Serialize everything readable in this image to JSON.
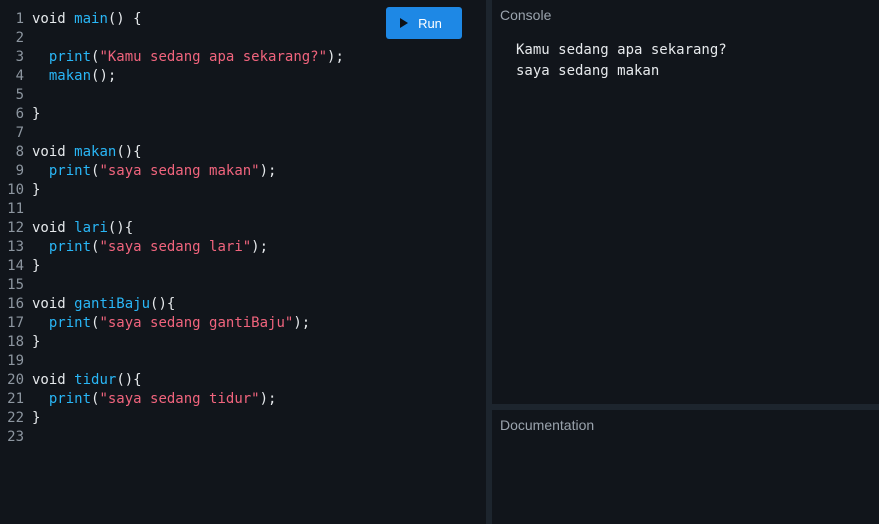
{
  "editor": {
    "run_label": "Run",
    "lines": [
      [
        {
          "t": "void ",
          "c": "plain"
        },
        {
          "t": "main",
          "c": "fn"
        },
        {
          "t": "() {",
          "c": "plain"
        }
      ],
      [],
      [
        {
          "t": "  ",
          "c": "plain"
        },
        {
          "t": "print",
          "c": "fn"
        },
        {
          "t": "(",
          "c": "plain"
        },
        {
          "t": "\"Kamu sedang apa sekarang?\"",
          "c": "str"
        },
        {
          "t": ");",
          "c": "plain"
        }
      ],
      [
        {
          "t": "  ",
          "c": "plain"
        },
        {
          "t": "makan",
          "c": "fn"
        },
        {
          "t": "();",
          "c": "plain"
        }
      ],
      [],
      [
        {
          "t": "}",
          "c": "plain"
        }
      ],
      [],
      [
        {
          "t": "void ",
          "c": "plain"
        },
        {
          "t": "makan",
          "c": "fn"
        },
        {
          "t": "(){",
          "c": "plain"
        }
      ],
      [
        {
          "t": "  ",
          "c": "plain"
        },
        {
          "t": "print",
          "c": "fn"
        },
        {
          "t": "(",
          "c": "plain"
        },
        {
          "t": "\"saya sedang makan\"",
          "c": "str"
        },
        {
          "t": ");",
          "c": "plain"
        }
      ],
      [
        {
          "t": "}",
          "c": "plain"
        }
      ],
      [],
      [
        {
          "t": "void ",
          "c": "plain"
        },
        {
          "t": "lari",
          "c": "fn"
        },
        {
          "t": "(){",
          "c": "plain"
        }
      ],
      [
        {
          "t": "  ",
          "c": "plain"
        },
        {
          "t": "print",
          "c": "fn"
        },
        {
          "t": "(",
          "c": "plain"
        },
        {
          "t": "\"saya sedang lari\"",
          "c": "str"
        },
        {
          "t": ");",
          "c": "plain"
        }
      ],
      [
        {
          "t": "}",
          "c": "plain"
        }
      ],
      [],
      [
        {
          "t": "void ",
          "c": "plain"
        },
        {
          "t": "gantiBaju",
          "c": "fn"
        },
        {
          "t": "(){",
          "c": "plain"
        }
      ],
      [
        {
          "t": "  ",
          "c": "plain"
        },
        {
          "t": "print",
          "c": "fn"
        },
        {
          "t": "(",
          "c": "plain"
        },
        {
          "t": "\"saya sedang gantiBaju\"",
          "c": "str"
        },
        {
          "t": ");",
          "c": "plain"
        }
      ],
      [
        {
          "t": "}",
          "c": "plain"
        }
      ],
      [],
      [
        {
          "t": "void ",
          "c": "plain"
        },
        {
          "t": "tidur",
          "c": "fn"
        },
        {
          "t": "(){",
          "c": "plain"
        }
      ],
      [
        {
          "t": "  ",
          "c": "plain"
        },
        {
          "t": "print",
          "c": "fn"
        },
        {
          "t": "(",
          "c": "plain"
        },
        {
          "t": "\"saya sedang tidur\"",
          "c": "str"
        },
        {
          "t": ");",
          "c": "plain"
        }
      ],
      [
        {
          "t": "}",
          "c": "plain"
        }
      ],
      []
    ]
  },
  "console": {
    "title": "Console",
    "output": "Kamu sedang apa sekarang?\nsaya sedang makan"
  },
  "documentation": {
    "title": "Documentation"
  },
  "colors": {
    "background": "#11151b",
    "accent": "#1e88e5",
    "function": "#29b6f6",
    "string": "#f0647d"
  }
}
